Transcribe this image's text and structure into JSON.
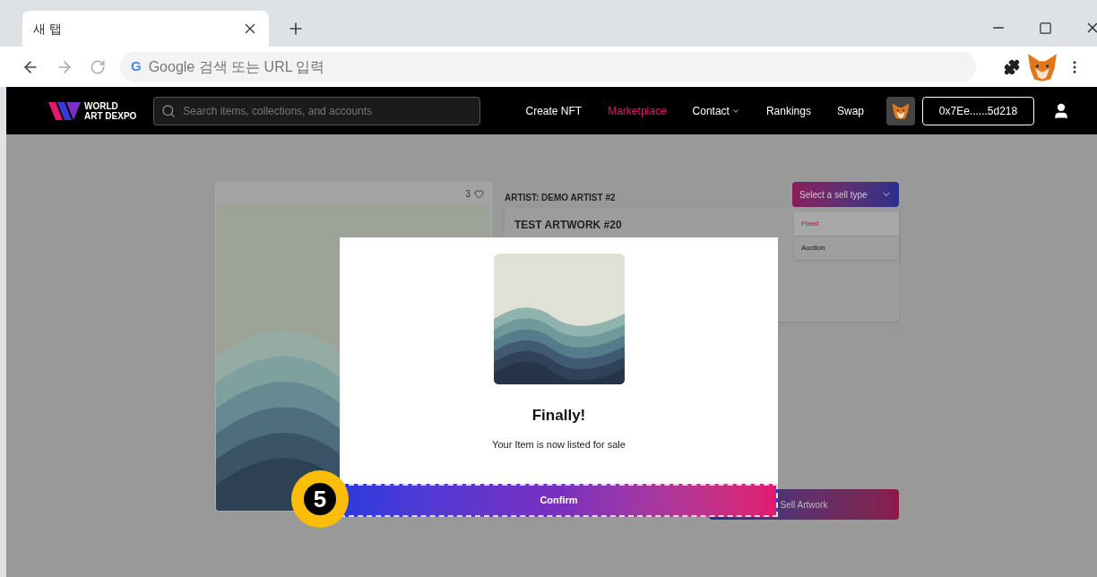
{
  "browser": {
    "tab": {
      "title": "새 탭"
    },
    "address_bar": {
      "engine_mark": "G",
      "placeholder": "Google 검색 또는 URL 입력"
    }
  },
  "site_nav": {
    "logo": [
      "WORLD",
      "ART DEXPO"
    ],
    "search": {
      "placeholder": "Search items, collections, and accounts"
    },
    "links": [
      {
        "label": "Create NFT",
        "selected": false,
        "has_menu": false
      },
      {
        "label": "Marketplace",
        "selected": true,
        "has_menu": false
      },
      {
        "label": "Contact",
        "selected": false,
        "has_menu": true
      },
      {
        "label": "Rankings",
        "selected": false,
        "has_menu": false
      },
      {
        "label": "Swap",
        "selected": false,
        "has_menu": false
      }
    ],
    "wallet": "0x7Ee......5d218"
  },
  "artwork": {
    "likes": "3"
  },
  "details": {
    "artist": "ARTIST: DEMO ARTIST #2",
    "title": "TEST ARTWORK #20"
  },
  "sell_type": {
    "label": "Select a sell type",
    "expanded": true,
    "options": [
      {
        "label": "Fixed",
        "selected": true
      },
      {
        "label": "Auction",
        "selected": false
      }
    ]
  },
  "sell_button": "Sell Artwork",
  "modal": {
    "title": "Finally!",
    "message": "Your Item is now listed for sale",
    "confirm": "Confirm"
  },
  "step_badge": "5"
}
